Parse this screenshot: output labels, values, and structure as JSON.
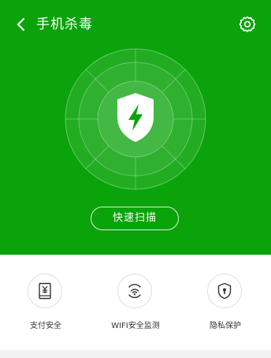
{
  "header": {
    "title": "手机杀毒",
    "back_icon": "chevron-left-icon",
    "settings_icon": "gear-icon"
  },
  "hero": {
    "background_color": "#0aa30a",
    "center_icon": "shield-lightning-icon",
    "scan_button_label": "快速扫描"
  },
  "features": [
    {
      "label": "支付安全",
      "icon": "yuan-phone-icon"
    },
    {
      "label": "WIFI安全监测",
      "icon": "wifi-icon"
    },
    {
      "label": "隐私保护",
      "icon": "shield-keyhole-icon"
    }
  ]
}
